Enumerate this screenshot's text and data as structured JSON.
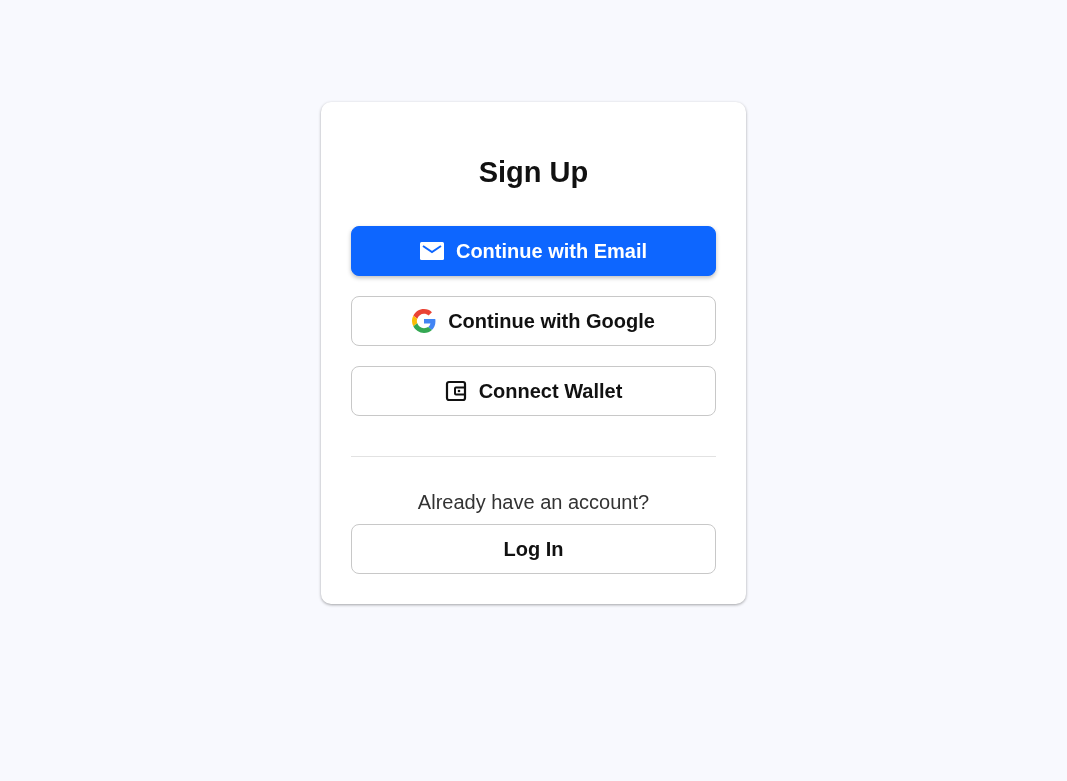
{
  "title": "Sign Up",
  "options": [
    {
      "kind": "email",
      "primary": true,
      "label": "Continue with Email"
    },
    {
      "kind": "google",
      "primary": false,
      "label": "Continue with Google"
    },
    {
      "kind": "wallet",
      "primary": false,
      "label": "Connect Wallet"
    }
  ],
  "login": {
    "prompt": "Already have an account?",
    "button": "Log In"
  }
}
